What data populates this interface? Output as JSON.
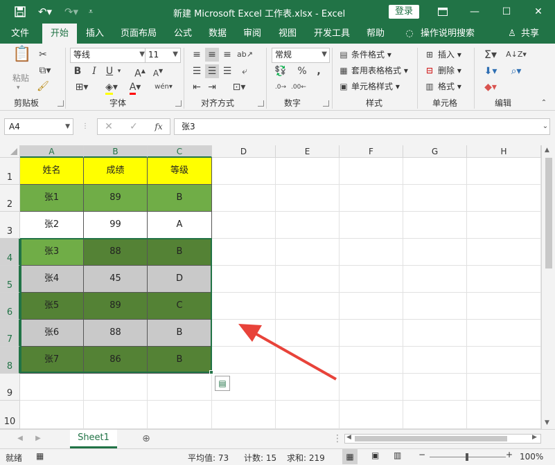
{
  "titlebar": {
    "title": "新建 Microsoft Excel 工作表.xlsx  -  Excel",
    "login": "登录",
    "icons": [
      "save-icon",
      "undo-icon",
      "redo-icon",
      "customize-icon"
    ]
  },
  "tabs": [
    "文件",
    "开始",
    "插入",
    "页面布局",
    "公式",
    "数据",
    "审阅",
    "视图",
    "开发工具",
    "帮助"
  ],
  "active_tab": "开始",
  "tell_me": "操作说明搜索",
  "share": "共享",
  "ribbon": {
    "clipboard": {
      "paste": "粘贴",
      "label": "剪贴板"
    },
    "font": {
      "name": "等线",
      "size": "11",
      "label": "字体",
      "bold": "B",
      "italic": "I",
      "underline": "U",
      "phonetic": "wén"
    },
    "alignment": {
      "label": "对齐方式"
    },
    "number": {
      "format": "常规",
      "label": "数字",
      "percent": "%",
      "comma": ","
    },
    "styles": {
      "conditional": "条件格式",
      "table": "套用表格格式",
      "cell": "单元格样式",
      "label": "样式"
    },
    "cells": {
      "insert": "插入",
      "delete": "删除",
      "format": "格式",
      "label": "单元格"
    },
    "editing": {
      "label": "编辑"
    }
  },
  "formula_bar": {
    "name_box": "A4",
    "value": "张3",
    "fx": "fx"
  },
  "columns": [
    "A",
    "B",
    "C",
    "D",
    "E",
    "F",
    "G",
    "H"
  ],
  "rows": [
    "1",
    "2",
    "3",
    "4",
    "5",
    "6",
    "7",
    "8",
    "9",
    "10"
  ],
  "table": [
    [
      "姓名",
      "成绩",
      "等级"
    ],
    [
      "张1",
      "89",
      "B"
    ],
    [
      "张2",
      "99",
      "A"
    ],
    [
      "张3",
      "88",
      "B"
    ],
    [
      "张4",
      "45",
      "D"
    ],
    [
      "张5",
      "89",
      "C"
    ],
    [
      "张6",
      "88",
      "B"
    ],
    [
      "张7",
      "86",
      "B"
    ]
  ],
  "colors": {
    "excel_green": "#217346",
    "header_yellow": "#ffff00",
    "light_green": "#70ad47",
    "dark_green": "#548235",
    "gray": "#c9c9c9",
    "arrow_red": "#e8433a"
  },
  "sheet_tab": "Sheet1",
  "status": {
    "ready": "就绪",
    "average": "平均值: 73",
    "count": "计数: 15",
    "sum": "求和: 219",
    "zoom": "100%"
  }
}
